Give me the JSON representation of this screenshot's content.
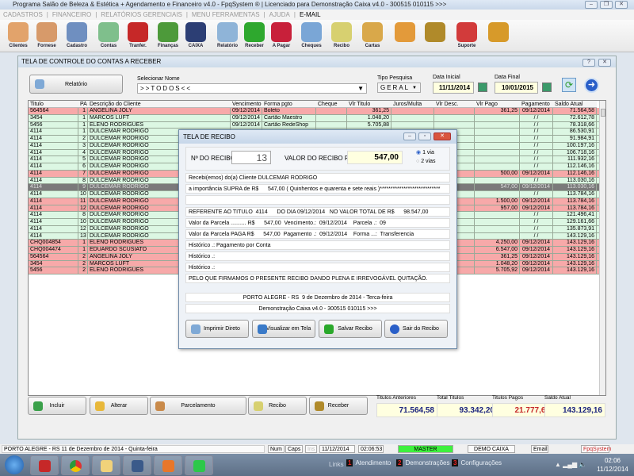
{
  "window": {
    "title": "Programa Salão de Beleza & Estética + Agendamento e Financeiro v4.0 - FpqSystem ® | Licenciado para  Demonstração Caixa v4.0 - 300515 010115 >>>"
  },
  "menu": [
    "CADASTROS",
    "FINANCEIRO",
    "RELATÓRIOS GERENCIAIS",
    "MENU FERRAMENTAS",
    "AJUDA",
    "E-MAIL"
  ],
  "toolbar": [
    {
      "label": "Clientes",
      "icon": "clients-icon",
      "color": "#e2a36b"
    },
    {
      "label": "Fornese",
      "icon": "supplier-icon",
      "color": "#d79a6a"
    },
    {
      "label": "Cadastro",
      "icon": "register-icon",
      "color": "#6f8fc0"
    },
    {
      "label": "Contas",
      "icon": "calendar-icon",
      "color": "#7fbf8c"
    },
    {
      "label": "Tranfer.",
      "icon": "transfer-icon",
      "color": "#c62828"
    },
    {
      "label": "Finanças",
      "icon": "finance-icon",
      "color": "#4d9a3a"
    },
    {
      "label": "CAIXA",
      "icon": "cashbook-icon",
      "color": "#2c3e74"
    },
    {
      "label": "Relatório",
      "icon": "printer-icon",
      "color": "#8fb4d8"
    },
    {
      "label": "Receber",
      "icon": "dollar-green-icon",
      "color": "#2ea82e"
    },
    {
      "label": "A Pagar",
      "icon": "dollar-red-icon",
      "color": "#c8203a"
    },
    {
      "label": "Cheques",
      "icon": "check-icon",
      "color": "#7aa6d6"
    },
    {
      "label": "Recibo",
      "icon": "receipt-icon",
      "color": "#d7d070"
    },
    {
      "label": "Cartas",
      "icon": "letter-icon",
      "color": "#d9a84a"
    },
    {
      "label": "",
      "icon": "calculator-icon",
      "color": "#e39a3a"
    },
    {
      "label": "",
      "icon": "coin-icon",
      "color": "#b08a2a"
    },
    {
      "label": "Suporte",
      "icon": "support-icon",
      "color": "#d23b3b"
    },
    {
      "label": "",
      "icon": "exit-icon",
      "color": "#d79a2a"
    }
  ],
  "form": {
    "title": "TELA DE CONTROLE DO CONTAS A RECEBER",
    "report_button": "Relatório",
    "name_label": "Selecionar Nome",
    "name_value": ">>TODOS<<",
    "type_label": "Tipo  Pesquisa",
    "type_value": "GERAL",
    "start_label": "Data Inicial",
    "start_value": "11/11/2014",
    "end_label": "Data Final",
    "end_value": "10/01/2015"
  },
  "table": {
    "columns": [
      "Titulo",
      "PA",
      "Descrição do Cliente",
      "Vencimento",
      "Forma pgto",
      "Cheque",
      "Vlr Titulo",
      "Juros/Multa",
      "Vlr Desc.",
      "Vlr Pago",
      "Pagamento",
      "Saldo Atual"
    ],
    "rows": [
      {
        "c": [
          "564564",
          "1",
          "ANGELINA JOLY",
          "09/12/2014",
          "Boleto",
          "",
          "361,25",
          "",
          "",
          "361,25",
          "09/12/2014",
          "71.564,58"
        ],
        "s": "r"
      },
      {
        "c": [
          "3454",
          "1",
          "MARCOS LUFT",
          "09/12/2014",
          "Cartão Maestro",
          "",
          "1.048,20",
          "",
          "",
          "",
          "/ /",
          "72.612,78"
        ],
        "s": "g"
      },
      {
        "c": [
          "5456",
          "1",
          "ELENO RODRIGUES",
          "09/12/2014",
          "Cartão RedeShop",
          "",
          "5.705,88",
          "",
          "",
          "",
          "/ /",
          "78.318,66"
        ],
        "s": "g"
      },
      {
        "c": [
          "4114",
          "1",
          "DULCEMAR RODRIGO",
          "",
          "",
          "",
          "",
          "",
          "",
          "",
          "/ /",
          "86.530,91"
        ],
        "s": "g"
      },
      {
        "c": [
          "4114",
          "2",
          "DULCEMAR RODRIGO",
          "",
          "",
          "",
          "",
          "",
          "",
          "",
          "/ /",
          "91.984,91"
        ],
        "s": "g"
      },
      {
        "c": [
          "4114",
          "3",
          "DULCEMAR RODRIGO",
          "",
          "",
          "",
          "",
          "",
          "",
          "",
          "/ /",
          "100.197,16"
        ],
        "s": "g"
      },
      {
        "c": [
          "4114",
          "4",
          "DULCEMAR RODRIGO",
          "",
          "",
          "",
          "",
          "",
          "",
          "",
          "/ /",
          "106.718,16"
        ],
        "s": "g"
      },
      {
        "c": [
          "4114",
          "5",
          "DULCEMAR RODRIGO",
          "",
          "",
          "",
          "",
          "",
          "",
          "",
          "/ /",
          "111.932,16"
        ],
        "s": "g"
      },
      {
        "c": [
          "4114",
          "6",
          "DULCEMAR RODRIGO",
          "",
          "",
          "",
          "",
          "",
          "",
          "",
          "/ /",
          "112.146,16"
        ],
        "s": "g"
      },
      {
        "c": [
          "4114",
          "7",
          "DULCEMAR RODRIGO",
          "",
          "",
          "",
          "",
          "",
          "",
          "500,00",
          "09/12/2014",
          "112.146,16"
        ],
        "s": "r"
      },
      {
        "c": [
          "4114",
          "8",
          "DULCEMAR RODRIGO",
          "",
          "",
          "",
          "",
          "",
          "",
          "",
          "/ /",
          "113.030,16"
        ],
        "s": "g"
      },
      {
        "c": [
          "4114",
          "9",
          "DULCEMAR RODRIGO",
          "",
          "",
          "",
          "",
          "",
          "",
          "547,00",
          "09/12/2014",
          "113.030,16"
        ],
        "s": "s"
      },
      {
        "c": [
          "4114",
          "10",
          "DULCEMAR RODRIGO",
          "",
          "",
          "",
          "",
          "",
          "",
          "",
          "/ /",
          "113.784,16"
        ],
        "s": "g"
      },
      {
        "c": [
          "4114",
          "11",
          "DULCEMAR RODRIGO",
          "",
          "",
          "",
          "",
          "",
          "",
          "1.500,00",
          "09/12/2014",
          "113.784,16"
        ],
        "s": "r"
      },
      {
        "c": [
          "4114",
          "12",
          "DULCEMAR RODRIGO",
          "",
          "",
          "",
          "",
          "",
          "",
          "957,00",
          "09/12/2014",
          "113.784,16"
        ],
        "s": "r"
      },
      {
        "c": [
          "4114",
          "8",
          "DULCEMAR RODRIGO",
          "",
          "",
          "",
          "",
          "",
          "",
          "",
          "/ /",
          "121.496,41"
        ],
        "s": "g"
      },
      {
        "c": [
          "4114",
          "10",
          "DULCEMAR RODRIGO",
          "",
          "",
          "",
          "",
          "",
          "",
          "",
          "/ /",
          "129.161,66"
        ],
        "s": "g"
      },
      {
        "c": [
          "4114",
          "12",
          "DULCEMAR RODRIGO",
          "",
          "",
          "",
          "",
          "",
          "",
          "",
          "/ /",
          "135.873,91"
        ],
        "s": "g"
      },
      {
        "c": [
          "4114",
          "13",
          "DULCEMAR RODRIGO",
          "",
          "",
          "",
          "",
          "",
          "",
          "",
          "/ /",
          "143.129,16"
        ],
        "s": "g"
      },
      {
        "c": [
          "CHQ004854",
          "1",
          "ELENO RODRIGUES",
          "",
          "",
          "",
          "",
          "",
          "",
          "4.250,00",
          "09/12/2014",
          "143.129,16"
        ],
        "s": "r"
      },
      {
        "c": [
          "CHQ004474",
          "1",
          "EDUARDO SCUSIATO",
          "",
          "",
          "",
          "",
          "",
          "",
          "6.547,00",
          "09/12/2014",
          "143.129,16"
        ],
        "s": "r"
      },
      {
        "c": [
          "564564",
          "2",
          "ANGELINA JOLY",
          "",
          "",
          "",
          "",
          "",
          "",
          "361,25",
          "09/12/2014",
          "143.129,16"
        ],
        "s": "r"
      },
      {
        "c": [
          "3454",
          "2",
          "MARCOS LUFT",
          "",
          "",
          "",
          "",
          "",
          "",
          "1.048,20",
          "09/12/2014",
          "143.129,16"
        ],
        "s": "r"
      },
      {
        "c": [
          "5456",
          "2",
          "ELENO RODRIGUES",
          "",
          "",
          "",
          "",
          "",
          "",
          "5.705,92",
          "09/12/2014",
          "143.129,16"
        ],
        "s": "r"
      }
    ]
  },
  "actions": [
    "Incluir",
    "Alterar",
    "Parcelamento",
    "Recibo",
    "Receber"
  ],
  "totals": [
    {
      "label": "Titulos Anteriores",
      "value": "71.564,58"
    },
    {
      "label": "Total Titulos",
      "value": "93.342,20"
    },
    {
      "label": "Titulos Pagos",
      "value": "21.777,62",
      "color": "#c62828"
    },
    {
      "label": "Saldo Atual",
      "value": "143.129,16"
    }
  ],
  "dialog": {
    "title": "TELA DE RECIBO",
    "num_label": "Nº DO RECIBO",
    "num_value": "13",
    "value_label": "VALOR DO RECIBO R$",
    "value_value": "547,00",
    "via1": "1 via",
    "via2": "2 vias",
    "lines": [
      "Recebi(emos) do(a) Cliente DULCEMAR RODRIGO",
      "a importância SUPRA de R$      547,00 ( Quinhentos e quarenta e sete reais )****************************",
      "",
      "REFERENTE AO TITULO  4114      DO DIA 09/12/2014   NO VALOR TOTAL DE R$      98.547,00",
      "Valor da Parcela .......... R$      547,00  Vencimento.:  09/12/2014    Parcela .:  09",
      "Valor da Parcela PAGA R$      547,00  Pagamento .:  09/12/2014    Forma ...:  Transferencia",
      "Histórico .: Pagamento por Conta",
      "Histórico .:",
      "Histórico .:",
      "PELO QUE FIRMAMOS O PRESENTE RECIBO DANDO PLENA E IRREVOGÁVEL QUITAÇÃO."
    ],
    "city_line": "PORTO ALEGRE - RS  9 de Dezembro de 2014 - Terca-feira",
    "license_line": "Demonstração Caixa v4.0 - 300515 010115 >>>",
    "buttons": [
      "Imprimir Direto",
      "Visualizar em Tela",
      "Salvar Recibo",
      "Sair do Recibo"
    ]
  },
  "status": {
    "city": "PORTO ALEGRE - RS 11 de Dezembro de 2014 - Quinta-feira",
    "num": "Num",
    "caps": "Caps",
    "ins": "Ins",
    "date": "11/12/2014",
    "time": "02:06:53",
    "user": "MASTER",
    "db": "DEMO CAIXA 4.0",
    "email": "Email",
    "brand": "FpqSystem"
  },
  "taskbar": {
    "links": "Links",
    "items": [
      {
        "n": "1",
        "label": "Atendimento"
      },
      {
        "n": "2",
        "label": "Demonstrações"
      },
      {
        "n": "3",
        "label": "Configurações"
      }
    ],
    "clock_time": "02:06",
    "clock_date": "11/12/2014"
  }
}
